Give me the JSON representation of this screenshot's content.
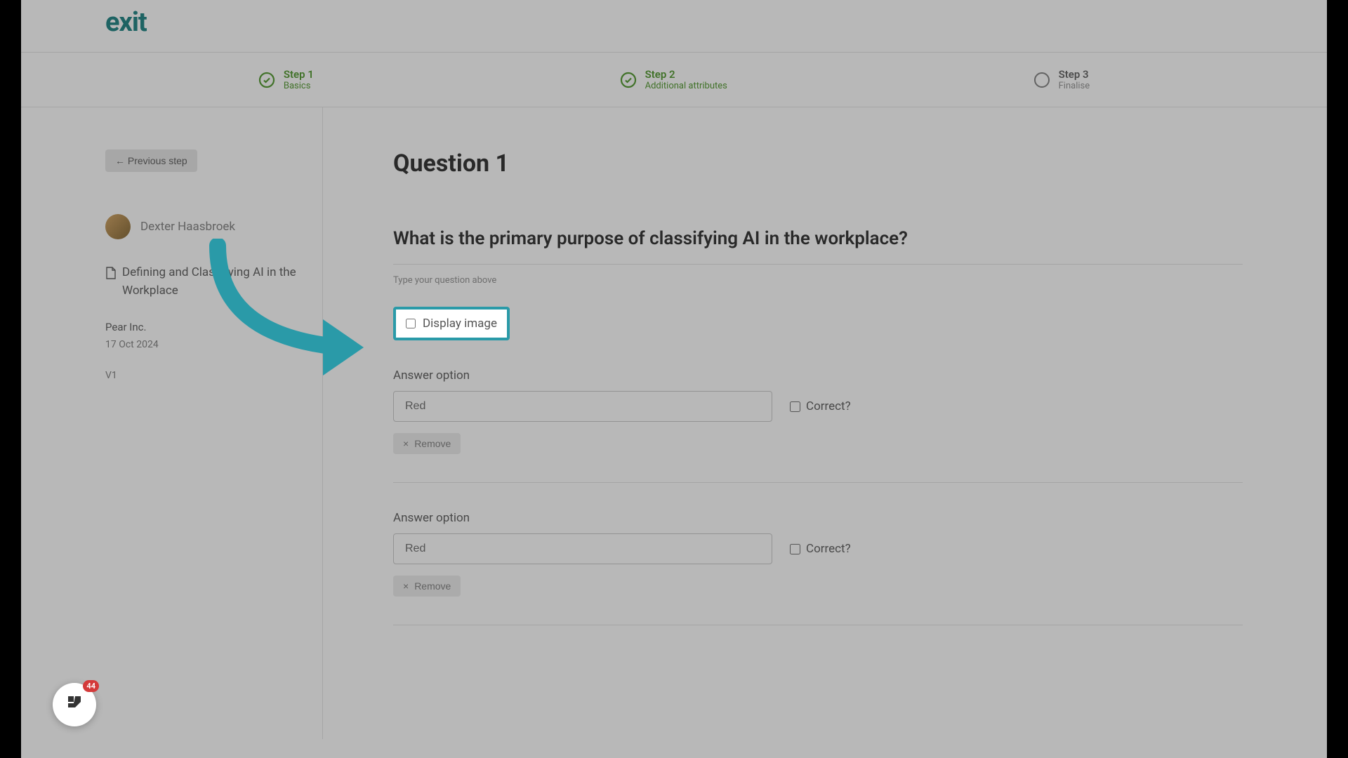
{
  "logo": "exit",
  "stepper": {
    "steps": [
      {
        "title": "Step 1",
        "sub": "Basics",
        "done": true
      },
      {
        "title": "Step 2",
        "sub": "Additional attributes",
        "done": true
      },
      {
        "title": "Step 3",
        "sub": "Finalise",
        "done": false
      }
    ]
  },
  "sidebar": {
    "prev_label": "←  Previous step",
    "author": "Dexter Haasbroek",
    "doc_title": "Defining and Classifying AI in the Workplace",
    "company": "Pear Inc.",
    "date": "17 Oct 2024",
    "version": "V1"
  },
  "main": {
    "question_heading": "Question 1",
    "question_text": "What is the primary purpose of classifying AI in the workplace?",
    "question_hint": "Type your question above",
    "display_image_label": "Display image",
    "answer_label": "Answer option",
    "correct_label": "Correct?",
    "remove_label": "Remove",
    "answers": [
      {
        "placeholder": "Red"
      },
      {
        "placeholder": "Red"
      }
    ]
  },
  "widget_badge": "44"
}
